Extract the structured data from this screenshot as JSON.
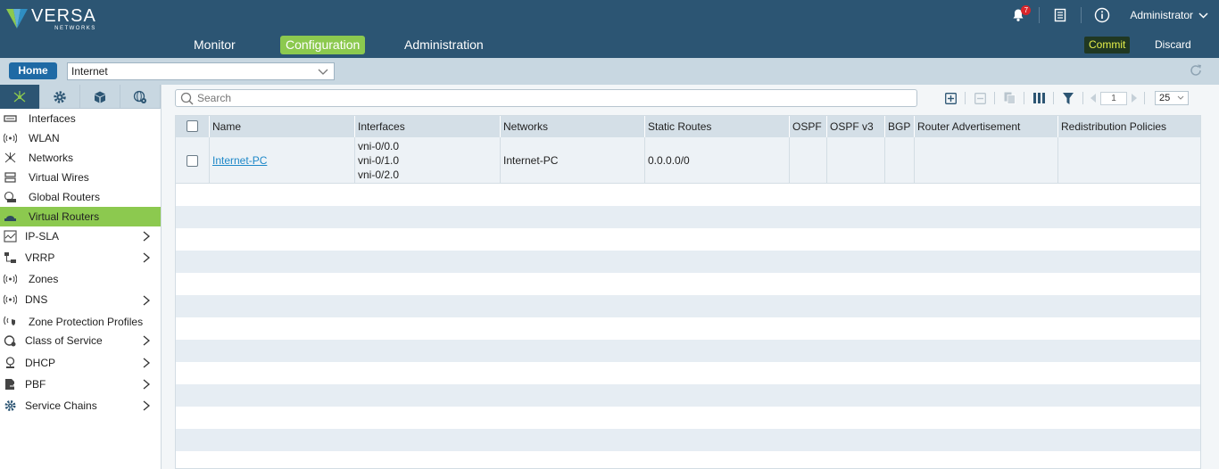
{
  "brand": {
    "name": "VERSA",
    "sub": "NETWORKS"
  },
  "header": {
    "notification_count": "7",
    "user": "Administrator",
    "nav": [
      {
        "label": "Monitor"
      },
      {
        "label": "Configuration"
      },
      {
        "label": "Administration"
      }
    ],
    "active_nav": "Configuration",
    "commit_label": "Commit",
    "discard_label": "Discard"
  },
  "subbar": {
    "home_label": "Home",
    "org_value": "Internet"
  },
  "sidebar": {
    "tabs": [
      "networking-icon",
      "gear-icon",
      "cube-icon",
      "globe-gear-icon"
    ],
    "items": [
      {
        "label": "Interfaces",
        "icon": "interface-icon"
      },
      {
        "label": "WLAN",
        "icon": "wlan-icon"
      },
      {
        "label": "Networks",
        "icon": "networks-icon"
      },
      {
        "label": "Virtual Wires",
        "icon": "virtual-wire-icon"
      },
      {
        "label": "Global Routers",
        "icon": "global-router-icon"
      },
      {
        "label": "Virtual Routers",
        "icon": "router-icon"
      },
      {
        "label": "IP-SLA",
        "icon": "ip-sla-icon"
      },
      {
        "label": "VRRP",
        "icon": "vrrp-icon"
      },
      {
        "label": "Zones",
        "icon": "zones-icon"
      },
      {
        "label": "DNS",
        "icon": "dns-icon"
      },
      {
        "label": "Zone Protection Profiles",
        "icon": "zone-protection-icon"
      },
      {
        "label": "Class of Service",
        "icon": "class-of-service-icon"
      },
      {
        "label": "DHCP",
        "icon": "dhcp-icon"
      },
      {
        "label": "PBF",
        "icon": "pbf-icon"
      },
      {
        "label": "Service Chains",
        "icon": "service-chains-icon"
      }
    ],
    "active_item": "Virtual Routers"
  },
  "main": {
    "search_placeholder": "Search",
    "pagination": {
      "page": "1",
      "page_size": "25"
    },
    "table": {
      "columns": [
        "Name",
        "Interfaces",
        "Networks",
        "Static Routes",
        "OSPF",
        "OSPF v3",
        "BGP",
        "Router Advertisement",
        "Redistribution Policies"
      ],
      "rows": [
        {
          "name": "Internet-PC",
          "interfaces": [
            "vni-0/0.0",
            "vni-0/1.0",
            "vni-0/2.0"
          ],
          "networks": "Internet-PC",
          "static_routes": "0.0.0.0/0",
          "ospf": "",
          "ospf_v3": "",
          "bgp": "",
          "router_advertisement": "",
          "redistribution_policies": ""
        }
      ]
    }
  },
  "colors": {
    "header_bg": "#2c5573",
    "accent_green": "#8cc94f",
    "subbar_bg": "#c8d7e1",
    "home_btn": "#1f6aa5",
    "link": "#1e88c8"
  }
}
